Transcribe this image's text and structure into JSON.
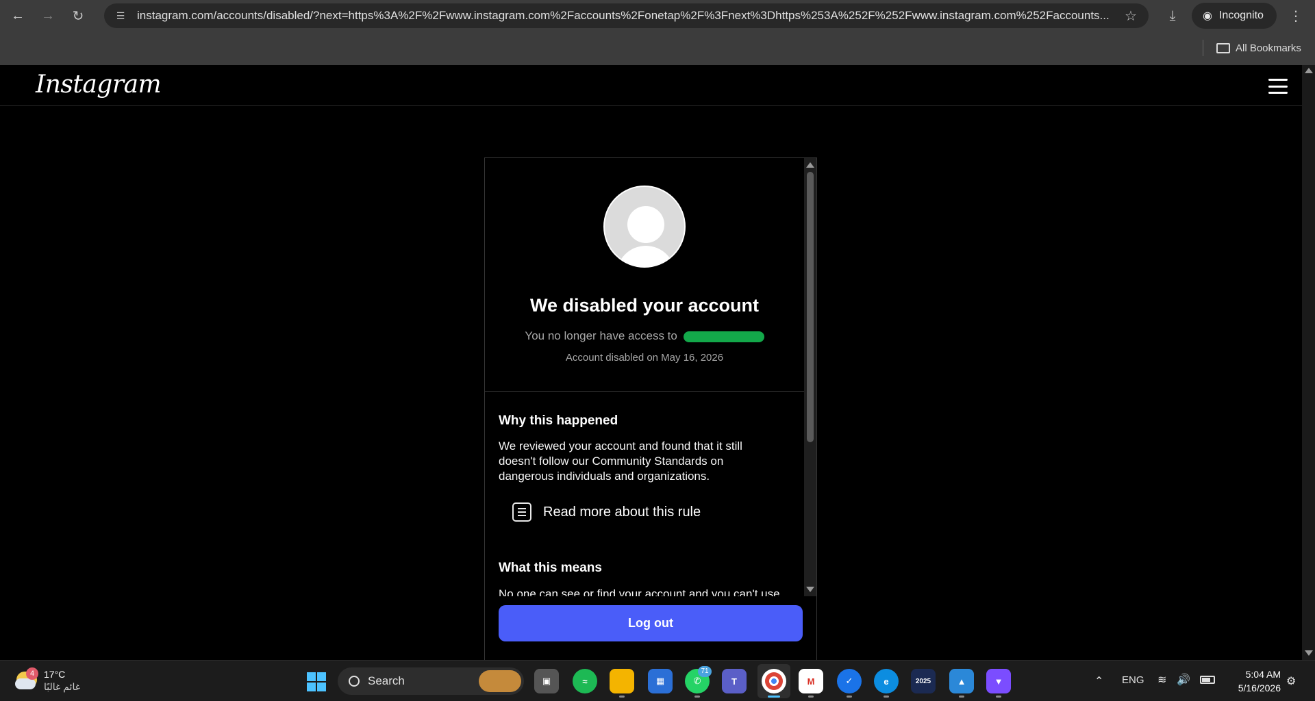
{
  "browser": {
    "url": "instagram.com/accounts/disabled/?next=https%3A%2F%2Fwww.instagram.com%2Faccounts%2Fonetap%2F%3Fnext%3Dhttps%253A%252F%252Fwww.instagram.com%252Faccounts...",
    "incognito_label": "Incognito",
    "bookmarks_label": "All Bookmarks"
  },
  "header": {
    "logo_text": "Instagram"
  },
  "card": {
    "title": "We disabled your account",
    "access_text": "You no longer have access to",
    "disabled_date": "Account disabled on May 16, 2026",
    "why_heading": "Why this happened",
    "why_body": "We reviewed your account and found that it still doesn't follow our Community Standards on dangerous individuals and organizations.",
    "rule_link": "Read more about this rule",
    "means_heading": "What this means",
    "means_body": "No one can see or find your account and you can't use",
    "logout_label": "Log out",
    "button_color": "#4a5df9",
    "redaction_color": "#13a84a"
  },
  "taskbar": {
    "weather_badge": "4",
    "temperature": "17°C",
    "condition": "غائم غالبًا",
    "search_label": "Search",
    "whatsapp_badge": "71",
    "app_2025_label": "2025",
    "language": "ENG",
    "time": "5:04 AM",
    "date": "5/16/2026"
  }
}
